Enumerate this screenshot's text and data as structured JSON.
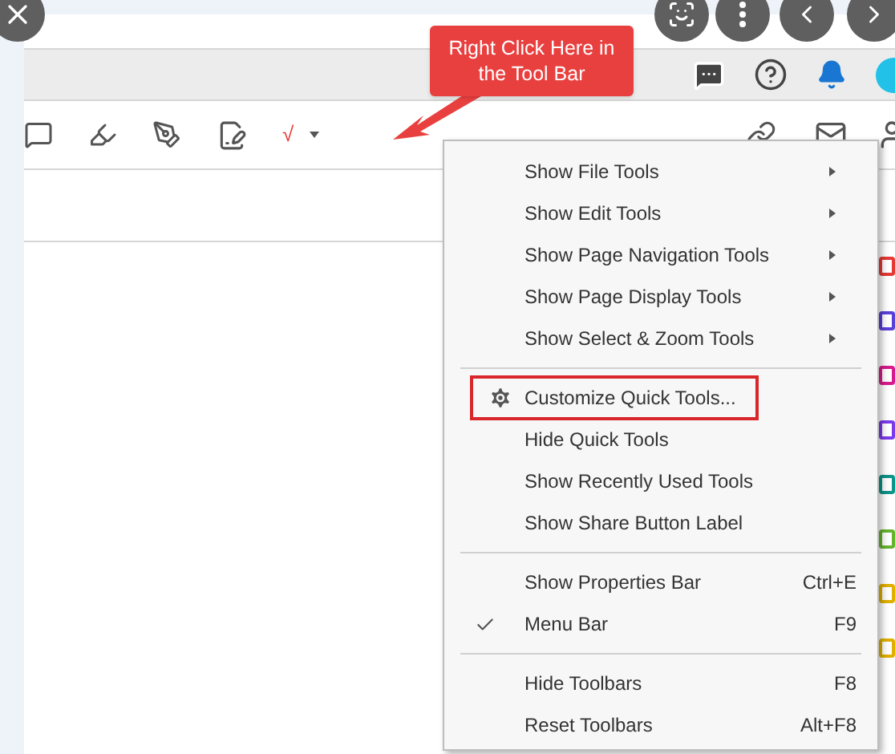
{
  "callout": {
    "text": "Right Click Here in the Tool Bar"
  },
  "toolbar": {
    "stamp_mark": "√"
  },
  "menu": {
    "sections": [
      [
        {
          "kind": "text",
          "label": "Show File Tools",
          "submenu": true,
          "checked": false,
          "outlined": false
        },
        {
          "kind": "text",
          "label": "Show Edit Tools",
          "submenu": true,
          "checked": false,
          "outlined": false
        },
        {
          "kind": "text",
          "label": "Show Page Navigation Tools",
          "submenu": true,
          "checked": false,
          "outlined": false
        },
        {
          "kind": "text",
          "label": "Show Page Display Tools",
          "submenu": true,
          "checked": false,
          "outlined": false
        },
        {
          "kind": "text",
          "label": "Show Select & Zoom Tools",
          "submenu": true,
          "checked": false,
          "outlined": false
        }
      ],
      [
        {
          "kind": "gear",
          "label": "Customize Quick Tools...",
          "submenu": false,
          "checked": false,
          "outlined": true
        },
        {
          "kind": "text",
          "label": "Hide Quick Tools",
          "submenu": false,
          "checked": false,
          "outlined": false
        },
        {
          "kind": "text",
          "label": "Show Recently Used Tools",
          "submenu": false,
          "checked": false,
          "outlined": false
        },
        {
          "kind": "text",
          "label": "Show Share Button Label",
          "submenu": false,
          "checked": false,
          "outlined": false
        }
      ],
      [
        {
          "kind": "text",
          "label": "Show Properties Bar",
          "shortcut": "Ctrl+E",
          "submenu": false,
          "checked": false,
          "outlined": false
        },
        {
          "kind": "text",
          "label": "Menu Bar",
          "shortcut": "F9",
          "submenu": false,
          "checked": true,
          "outlined": false
        }
      ],
      [
        {
          "kind": "text",
          "label": "Hide Toolbars",
          "shortcut": "F8",
          "submenu": false,
          "checked": false,
          "outlined": false
        },
        {
          "kind": "text",
          "label": "Reset Toolbars",
          "shortcut": "Alt+F8",
          "submenu": false,
          "checked": false,
          "outlined": false
        }
      ]
    ]
  }
}
